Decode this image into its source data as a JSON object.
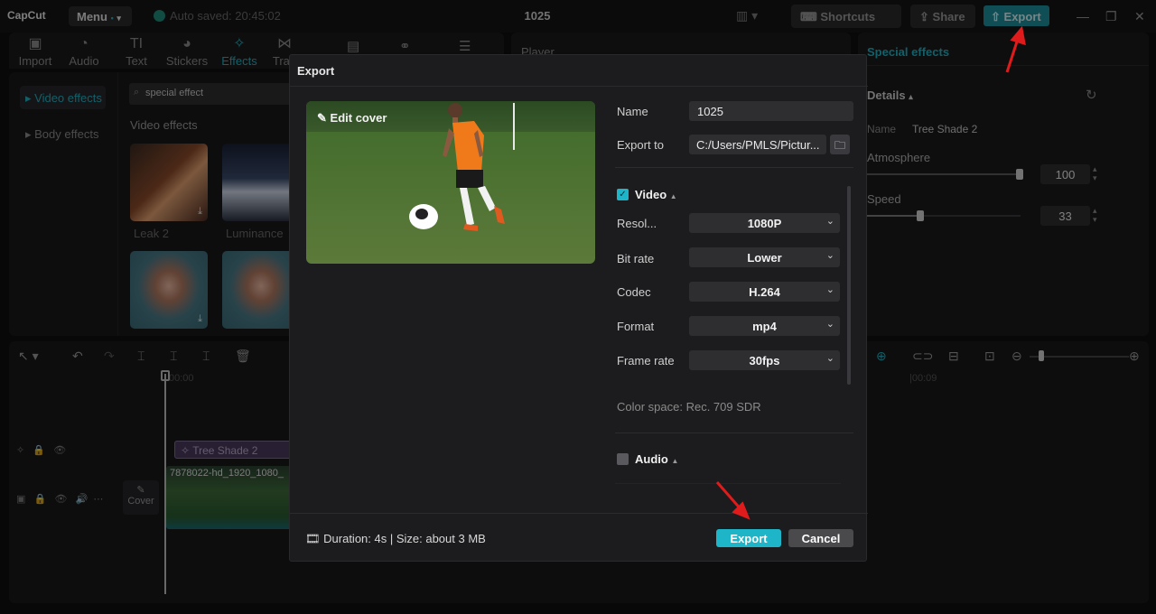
{
  "app": {
    "logo": "CapCut",
    "menu_label": "Menu",
    "autosave": "Auto saved: 20:45:02",
    "project_title": "1025",
    "shortcuts_label": "Shortcuts",
    "share_label": "Share",
    "export_label": "Export"
  },
  "media_tabs": [
    {
      "label": "Import",
      "icon": "import-icon"
    },
    {
      "label": "Audio",
      "icon": "audio-icon"
    },
    {
      "label": "Text",
      "icon": "text-icon"
    },
    {
      "label": "Stickers",
      "icon": "stickers-icon"
    },
    {
      "label": "Effects",
      "icon": "effects-icon"
    },
    {
      "label": "Tran",
      "icon": "transitions-icon"
    }
  ],
  "sidebar": {
    "items": [
      {
        "label": "▸ Video effects"
      },
      {
        "label": "▸ Body effects"
      }
    ]
  },
  "effects": {
    "search_value": "special effect",
    "section_title": "Video effects",
    "items": [
      {
        "label": "Leak 2"
      },
      {
        "label": "Luminance"
      }
    ]
  },
  "player": {
    "title": "Player"
  },
  "right_panel": {
    "tab": "Special effects",
    "details_label": "Details",
    "name_label": "Name",
    "name_value": "Tree Shade 2",
    "atmosphere_label": "Atmosphere",
    "atmosphere_value": "100",
    "speed_label": "Speed",
    "speed_value": "33"
  },
  "timeline": {
    "time_start": "00:00",
    "time_end": "|00:09",
    "effect_clip": "Tree Shade 2",
    "video_clip": "7878022-hd_1920_1080_",
    "cover_label": "Cover"
  },
  "dialog": {
    "title": "Export",
    "edit_cover": "Edit cover",
    "name_label": "Name",
    "name_value": "1025",
    "export_to_label": "Export to",
    "export_to_value": "C:/Users/PMLS/Pictur...",
    "video_section": "Video",
    "resolution_label": "Resol...",
    "resolution_value": "1080P",
    "bitrate_label": "Bit rate",
    "bitrate_value": "Lower",
    "codec_label": "Codec",
    "codec_value": "H.264",
    "format_label": "Format",
    "format_value": "mp4",
    "framerate_label": "Frame rate",
    "framerate_value": "30fps",
    "color_space": "Color space: Rec. 709 SDR",
    "audio_section": "Audio",
    "footer_info": "Duration: 4s | Size: about 3 MB",
    "export_button": "Export",
    "cancel_button": "Cancel"
  },
  "colors": {
    "accent": "#1fb5c9",
    "arrow": "#e01b1b"
  }
}
